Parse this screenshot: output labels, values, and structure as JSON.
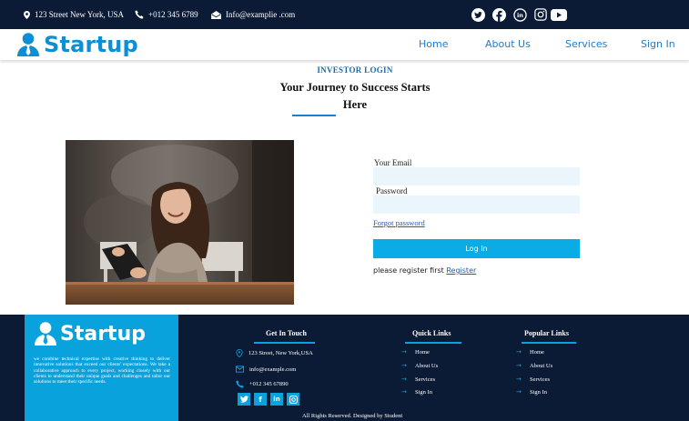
{
  "topbar": {
    "address": "123 Street New York, USA",
    "phone": "+012 345 6789",
    "email": "Info@examplie .com",
    "social_icons": [
      "twitter-icon",
      "facebook-icon",
      "linkedin-icon",
      "instagram-icon",
      "youtube-icon"
    ]
  },
  "nav": {
    "brand": "Startup",
    "links": [
      "Home",
      "About Us",
      "Services",
      "Sign In"
    ]
  },
  "heading": {
    "subtitle": "INVESTOR LOGIN",
    "title": "Your Journey to Success Starts Here"
  },
  "form": {
    "email_label": "Your Email",
    "password_label": "Password",
    "forgot_link": "Forgot password",
    "login_button": "Log In",
    "register_text": "please register first",
    "register_link": "Register"
  },
  "footer": {
    "brand": "Startup",
    "about": "we combine technical expertise with creative thinking to deliver innovative solutions that exceed our clients' expectations. We take a collaborative approach to every project, working closely with our clients to understand their unique goals and challenges and tailor our solutions to meet their specific needs.",
    "get_in_touch": {
      "title": "Get In Touch",
      "address": "123 Street, New York,USA",
      "email": "info@example.com",
      "phone": "+012 345 67890"
    },
    "quick_links": {
      "title": "Quick Links",
      "items": [
        "Home",
        "About Us",
        "Services",
        "Sign In"
      ]
    },
    "popular_links": {
      "title": "Popular Links",
      "items": [
        "Home",
        "About Us",
        "Services",
        "Sign In"
      ]
    },
    "social_buttons": [
      "twitter-icon",
      "facebook-icon",
      "linkedin-icon",
      "instagram-icon"
    ],
    "copyright": "All Rights Reserved. Designed by Student"
  },
  "colors": {
    "navy": "#0b1a35",
    "brand_blue": "#0d8fd6",
    "accent_cyan": "#0aace5",
    "input_bg": "#eaf5fc"
  }
}
